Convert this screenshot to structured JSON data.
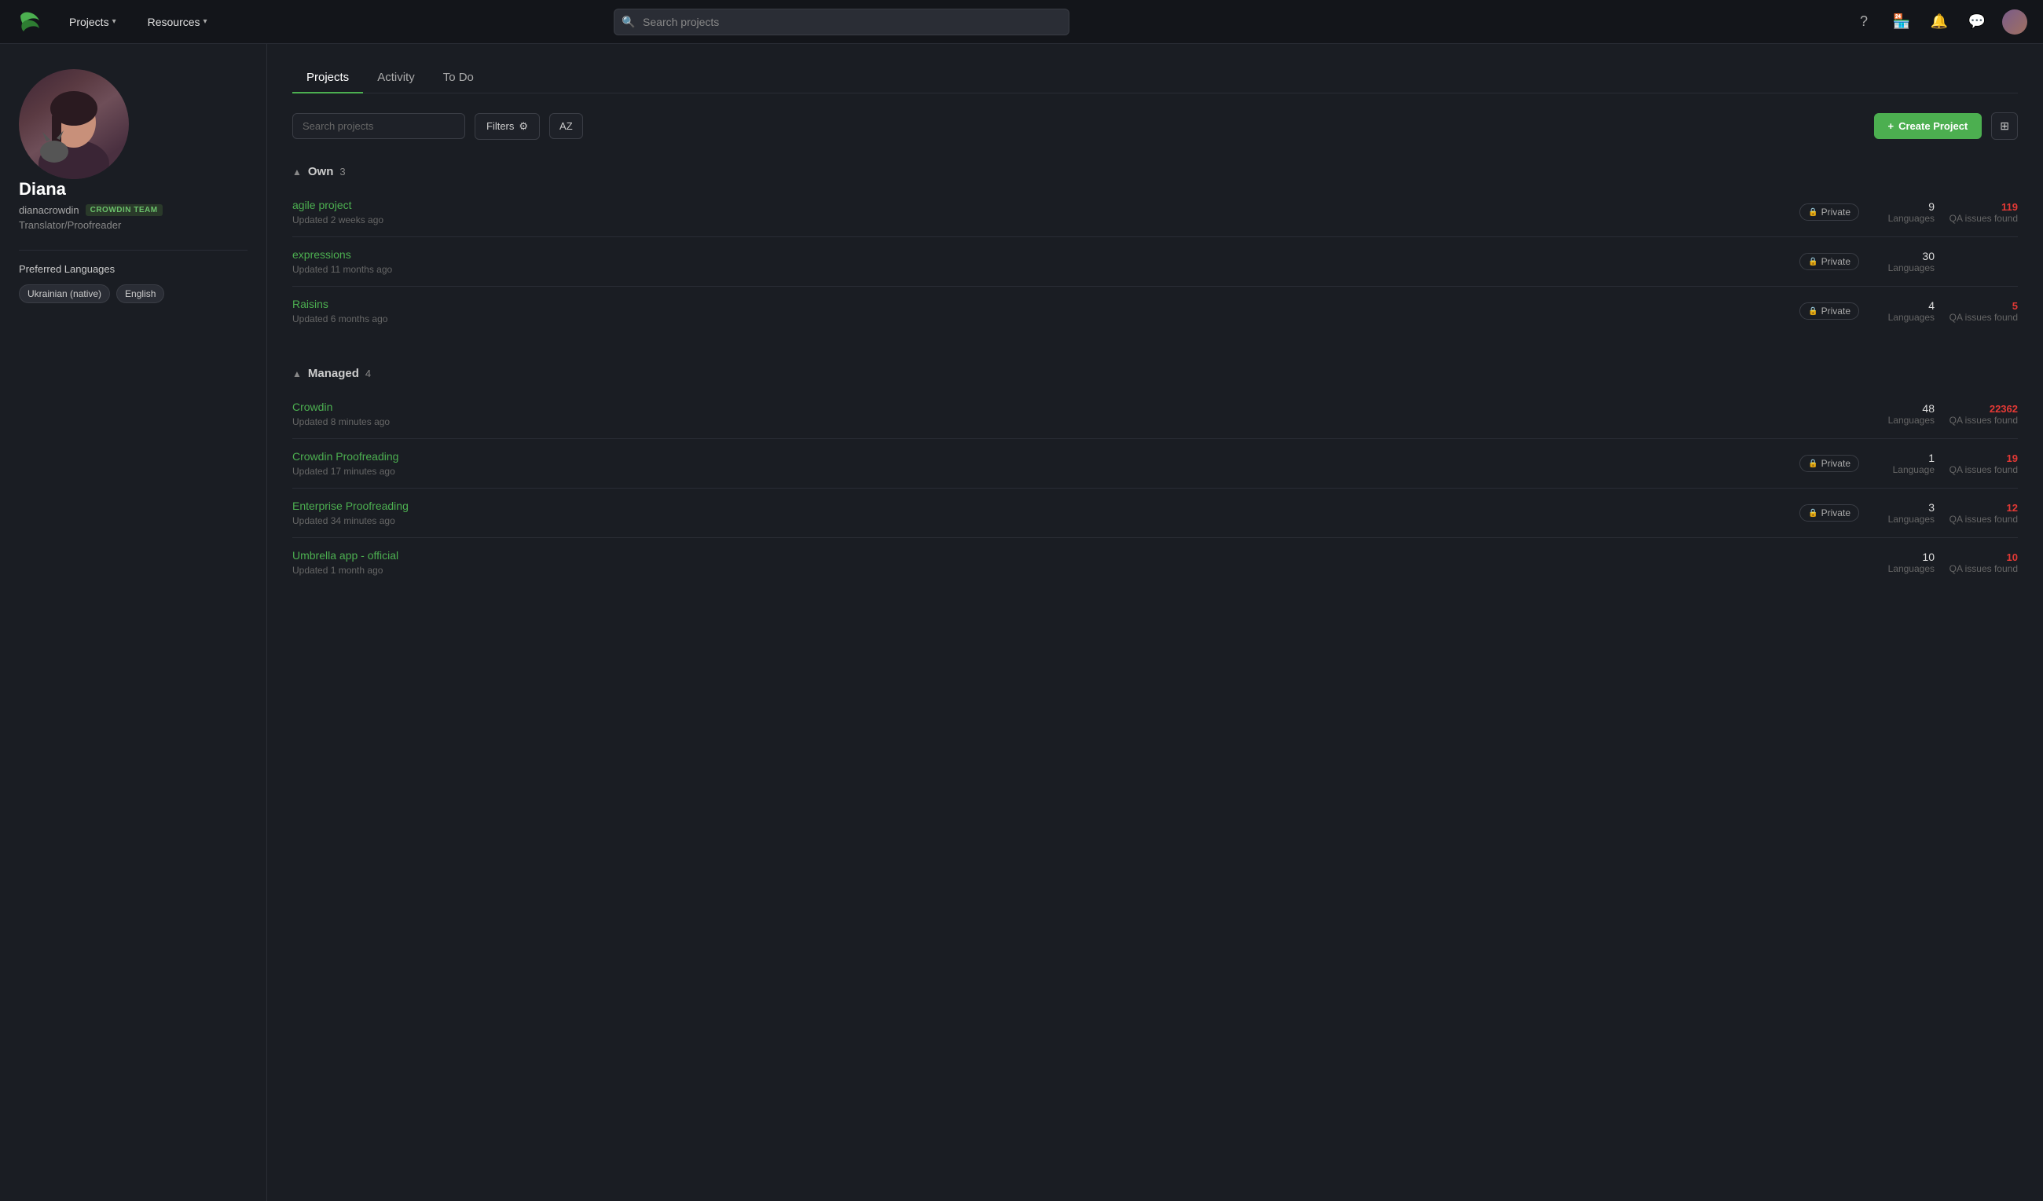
{
  "navbar": {
    "logo_alt": "Crowdin logo",
    "projects_label": "Projects",
    "resources_label": "Resources",
    "search_placeholder": "Search projects"
  },
  "sidebar": {
    "profile": {
      "name": "Diana",
      "username": "dianacrowdin",
      "team_badge": "CROWDIN TEAM",
      "role": "Translator/Proofreader"
    },
    "preferred_languages_label": "Preferred Languages",
    "languages": [
      {
        "label": "Ukrainian (native)"
      },
      {
        "label": "English"
      }
    ]
  },
  "tabs": [
    {
      "label": "Projects",
      "active": true
    },
    {
      "label": "Activity",
      "active": false
    },
    {
      "label": "To Do",
      "active": false
    }
  ],
  "toolbar": {
    "search_placeholder": "Search projects",
    "filters_label": "Filters",
    "az_label": "AZ",
    "create_label": "Create Project"
  },
  "own_section": {
    "title": "Own",
    "count": "3",
    "projects": [
      {
        "name": "agile project",
        "updated": "Updated 2 weeks ago",
        "private": true,
        "languages_count": "9",
        "languages_label": "Languages",
        "qa_count": "119",
        "qa_label": "QA issues found"
      },
      {
        "name": "expressions",
        "updated": "Updated 11 months ago",
        "private": true,
        "languages_count": "30",
        "languages_label": "Languages",
        "qa_count": null,
        "qa_label": null
      },
      {
        "name": "Raisins",
        "updated": "Updated 6 months ago",
        "private": true,
        "languages_count": "4",
        "languages_label": "Languages",
        "qa_count": "5",
        "qa_label": "QA issues found"
      }
    ]
  },
  "managed_section": {
    "title": "Managed",
    "count": "4",
    "projects": [
      {
        "name": "Crowdin",
        "updated": "Updated 8 minutes ago",
        "private": false,
        "languages_count": "48",
        "languages_label": "Languages",
        "qa_count": "22362",
        "qa_label": "QA issues found"
      },
      {
        "name": "Crowdin Proofreading",
        "updated": "Updated 17 minutes ago",
        "private": true,
        "languages_count": "1",
        "languages_label": "Language",
        "qa_count": "19",
        "qa_label": "QA issues found"
      },
      {
        "name": "Enterprise Proofreading",
        "updated": "Updated 34 minutes ago",
        "private": true,
        "languages_count": "3",
        "languages_label": "Languages",
        "qa_count": "12",
        "qa_label": "QA issues found"
      },
      {
        "name": "Umbrella app - official",
        "updated": "Updated 1 month ago",
        "private": false,
        "languages_count": "10",
        "languages_label": "Languages",
        "qa_count": "10",
        "qa_label": "QA issues found"
      }
    ]
  }
}
